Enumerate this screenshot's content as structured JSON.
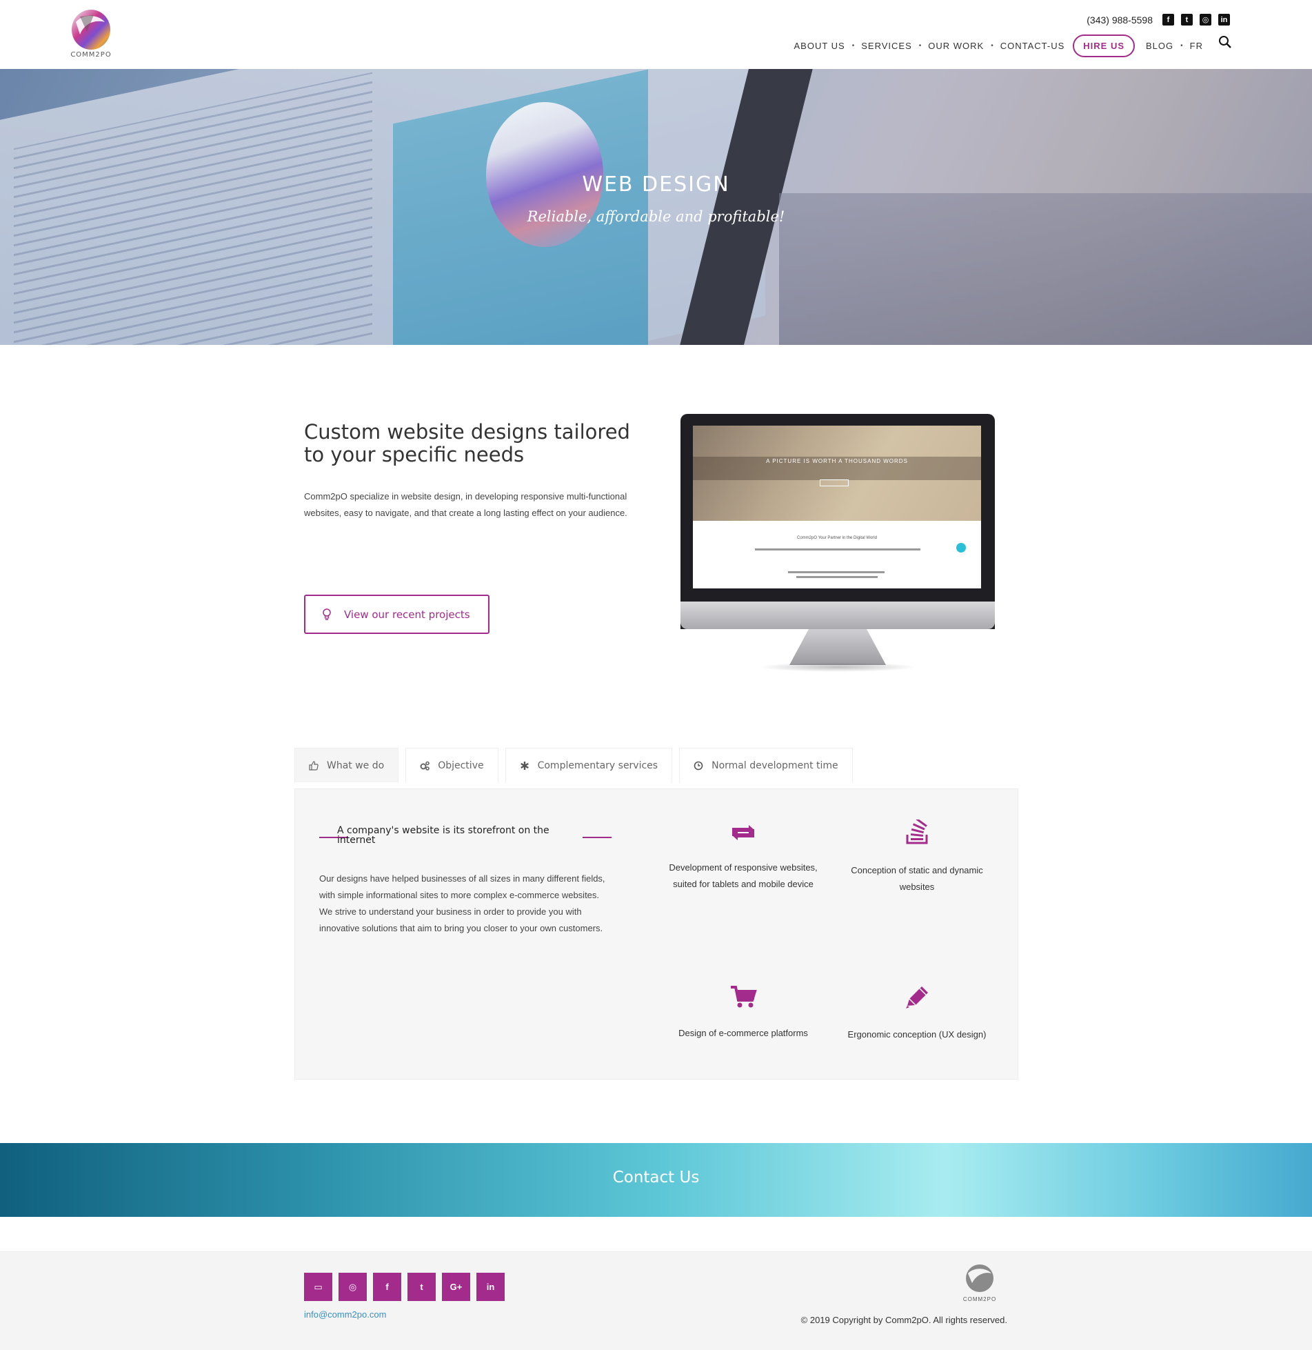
{
  "header": {
    "brand": "COMM2PO",
    "phone": "(343) 988-5598",
    "social_icons": [
      "facebook-icon",
      "twitter-icon",
      "instagram-icon",
      "linkedin-icon"
    ],
    "nav": {
      "about": "ABOUT US",
      "services": "SERVICES",
      "work": "OUR WORK",
      "contact": "CONTACT-US",
      "hire": "HIRE US",
      "blog": "BLOG",
      "lang": "FR"
    },
    "accent": "#a32b8c"
  },
  "hero": {
    "title": "WEB DESIGN",
    "subtitle": "Reliable, affordable and profitable!"
  },
  "intro": {
    "title": "Custom website designs tailored to your specific needs",
    "text": "Comm2pO specialize in website design, in developing responsive multi-functional websites, easy to navigate, and that create a long lasting effect on your audience.",
    "cta": "View our recent projects"
  },
  "mockup": {
    "headline": "A PICTURE IS WORTH A THOUSAND WORDS",
    "tagline": "Comm2pO Your Partner in the Digital World"
  },
  "tabs": [
    {
      "label": "What we do",
      "icon": "thumbs-up-icon"
    },
    {
      "label": "Objective",
      "icon": "gears-icon"
    },
    {
      "label": "Complementary services",
      "icon": "asterisk-icon"
    },
    {
      "label": "Normal development time",
      "icon": "clock-icon"
    }
  ],
  "what_we_do": {
    "title": "A company's website is its storefront on the internet",
    "text": "Our designs have helped businesses of all sizes in many different fields, with simple informational sites to more complex e-commerce websites. We strive to understand your business in order to provide you with innovative solutions that aim to bring you closer to your own customers.",
    "features": [
      {
        "label": "Development of responsive websites, suited for tablets and mobile device",
        "icon": "retweet-icon"
      },
      {
        "label": "Conception of static and dynamic websites",
        "icon": "stack-icon"
      },
      {
        "label": "Design of e-commerce platforms",
        "icon": "cart-icon"
      },
      {
        "label": "Ergonomic conception (UX design)",
        "icon": "pencil-icon"
      }
    ]
  },
  "contact": {
    "label": "Contact Us"
  },
  "footer": {
    "social": [
      "card-icon",
      "instagram-icon",
      "facebook-icon",
      "twitter-icon",
      "google-plus-icon",
      "linkedin-icon"
    ],
    "social_glyphs": [
      "▭",
      "◎",
      "f",
      "t",
      "G+",
      "in"
    ],
    "email": "info@comm2po.com",
    "brand": "COMM2PO",
    "copyright": "© 2019 Copyright by Comm2pO. All rights reserved."
  }
}
